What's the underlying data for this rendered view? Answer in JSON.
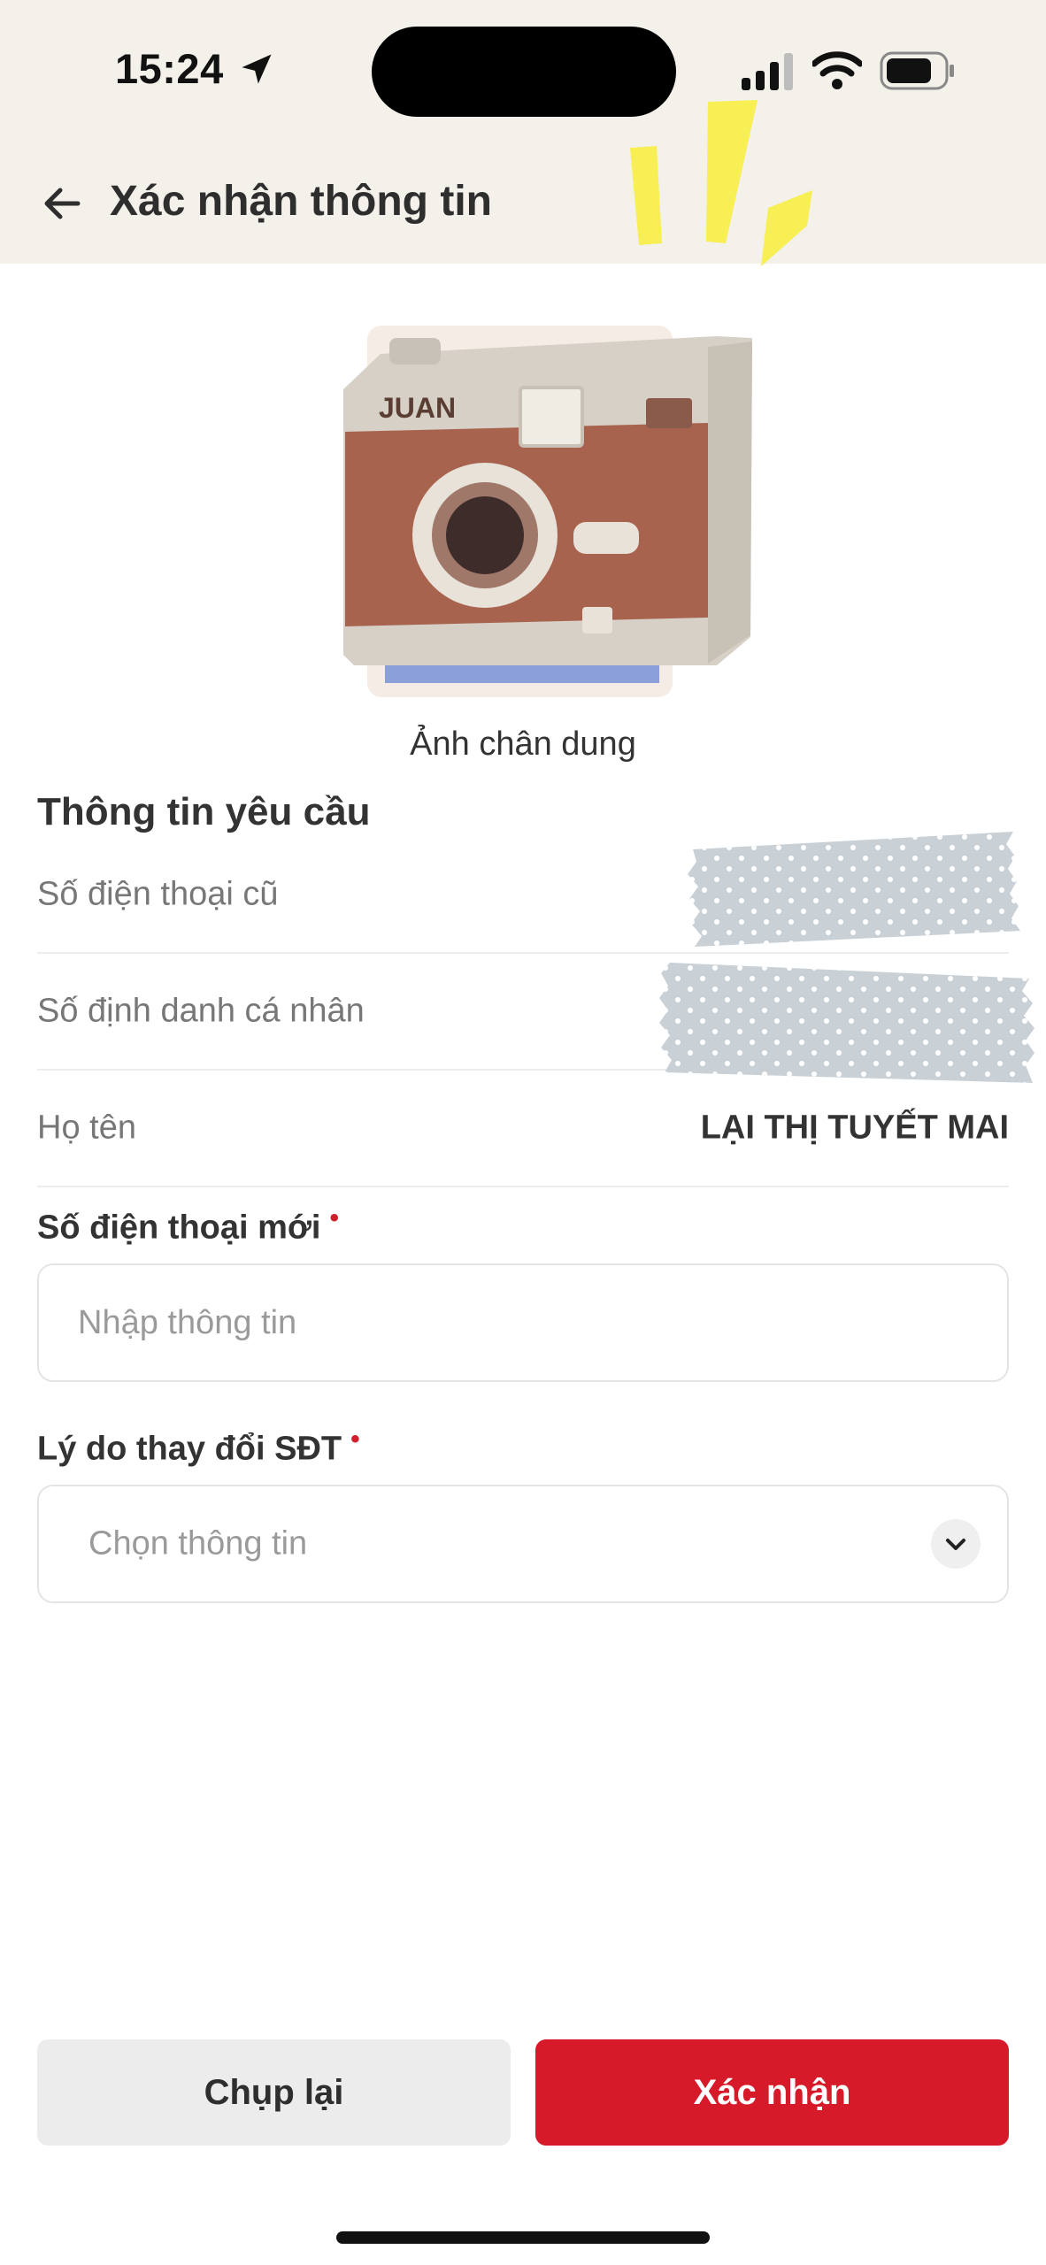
{
  "status_bar": {
    "time": "15:24"
  },
  "header": {
    "title": "Xác nhận thông tin"
  },
  "portrait": {
    "caption": "Ảnh chân dung",
    "camera_brand": "JUAN"
  },
  "info_section": {
    "title": "Thông tin yêu cầu",
    "rows": [
      {
        "label": "Số điện thoại cũ",
        "value": ""
      },
      {
        "label": "Số định danh cá nhân",
        "value": ""
      },
      {
        "label": "Họ tên",
        "value": "LẠI THỊ TUYẾT MAI"
      }
    ]
  },
  "form": {
    "new_phone": {
      "label": "Số điện thoại mới",
      "required_mark": "•",
      "placeholder": "Nhập thông tin",
      "value": ""
    },
    "reason": {
      "label": "Lý do thay đổi SĐT",
      "required_mark": "•",
      "placeholder": "Chọn thông tin"
    }
  },
  "actions": {
    "retake_label": "Chụp lại",
    "confirm_label": "Xác nhận"
  },
  "colors": {
    "primary": "#d71a29",
    "header_bg": "#f4f0ea",
    "secondary_button": "#ececec"
  }
}
